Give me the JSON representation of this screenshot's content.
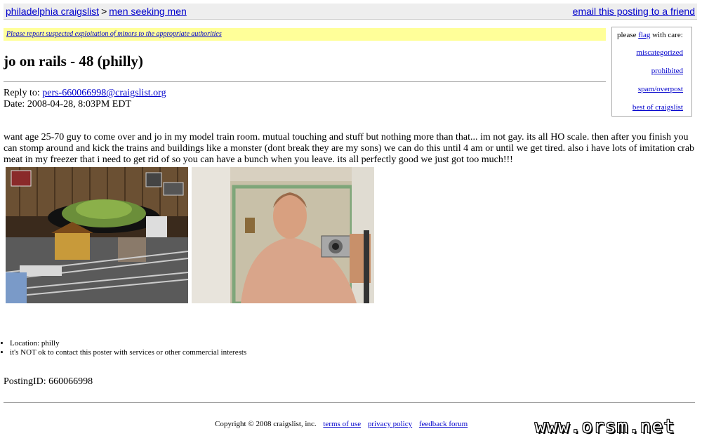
{
  "nav": {
    "site_link": "philadelphia craigslist",
    "separator": ">",
    "category_link": "men seeking men",
    "email_friend": "email this posting to a friend"
  },
  "warning": {
    "text": "Please report suspected exploitation of minors to the appropriate authorities"
  },
  "posting": {
    "title": "jo on rails - 48 (philly)",
    "reply_label": "Reply to:",
    "reply_email": "pers-660066998@craigslist.org",
    "date": "Date: 2008-04-28, 8:03PM EDT",
    "body": "want age 25-70 guy to come over and jo in my model train room. mutual touching and stuff but nothing more than that... im not gay. its all HO scale. then after you finish you can stomp around and kick the trains and buildings like a monster (dont break they are my sons) we can do this until 4 am or until we get tired. also i have lots of imitation crab meat in my freezer that i need to get rid of so you can have a bunch when you leave. its all perfectly good we just got too much!!!",
    "info": [
      "Location: philly",
      "it's NOT ok to contact this poster with services or other commercial interests"
    ],
    "posting_id": "PostingID: 660066998"
  },
  "flag": {
    "header_before": "please",
    "header_link": "flag",
    "header_after": "with care:",
    "items": [
      "miscategorized",
      "prohibited",
      "spam/overpost",
      "best of craigslist"
    ]
  },
  "footer": {
    "copyright": "Copyright © 2008 craigslist, inc.",
    "links": [
      "terms of use",
      "privacy policy",
      "feedback forum"
    ]
  },
  "watermark": "www.orsm.net"
}
